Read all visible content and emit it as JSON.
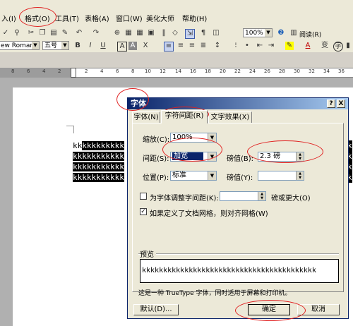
{
  "menubar": {
    "items": [
      "入(I)",
      "格式(O)",
      "工具(T)",
      "表格(A)",
      "窗口(W)",
      "美化大师",
      "帮助(H)"
    ]
  },
  "toolbar1": {
    "zoom": "100%",
    "reading": "阅读(R)"
  },
  "toolbar2": {
    "font": "ew Roman",
    "size": "五号"
  },
  "ruler": {
    "ticks": [
      "8",
      "6",
      "4",
      "2",
      "2",
      "4",
      "6",
      "8",
      "10",
      "12",
      "14",
      "16",
      "18",
      "20",
      "22",
      "24",
      "26",
      "28",
      "30",
      "32",
      "34",
      "36"
    ]
  },
  "document": {
    "lines": [
      {
        "plain": "kk",
        "highlight": "kkkkkkkkk"
      },
      {
        "plain": "",
        "highlight": "kkkkkkkkkkk"
      },
      {
        "plain": "",
        "highlight": "kkkkkkkkkkk"
      },
      {
        "plain": "",
        "highlight": "kkkkkkkkkkk"
      }
    ],
    "right_k": [
      "k",
      "k",
      "k",
      "k"
    ]
  },
  "dialog": {
    "title": "字体",
    "help_button": "?",
    "close_button": "X",
    "tabs": [
      "字体(N)",
      "字符间距(R)",
      "文字效果(X)"
    ],
    "scale_label": "缩放(C):",
    "scale_value": "100%",
    "spacing_label": "间距(S):",
    "spacing_value": "加宽",
    "spacing_by_label": "磅值(B):",
    "spacing_by_value": "2.3 磅",
    "position_label": "位置(P):",
    "position_value": "标准",
    "position_by_label": "磅值(Y):",
    "position_by_value": "",
    "kerning_label": "为字体调整字间距(K):",
    "kerning_value": "",
    "kerning_suffix": "磅或更大(O)",
    "kerning_checked": false,
    "grid_label": "如果定义了文档网格，则对齐网格(W)",
    "grid_checked": true,
    "preview_label": "预览",
    "preview_text": "kkkkkkkkkkkkkkkkkkkkkkkkkkkkkkkkkkkkkkkkk",
    "info_text": "这是一种 TrueType 字体，同时适用于屏幕和打印机。",
    "default_button": "默认(D)...",
    "ok_button": "确定",
    "cancel_button": "取消"
  }
}
